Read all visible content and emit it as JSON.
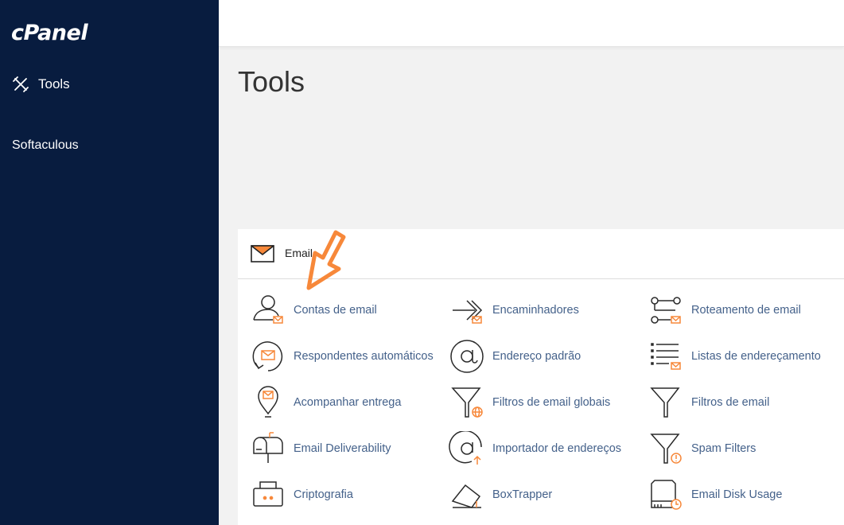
{
  "sidebar": {
    "logo": "cPanel",
    "tools_label": "Tools",
    "softaculous_label": "Softaculous"
  },
  "page": {
    "title": "Tools"
  },
  "email_section": {
    "title": "Email",
    "items": [
      {
        "label": "Contas de email",
        "icon": "email-accounts-icon"
      },
      {
        "label": "Encaminhadores",
        "icon": "forwarders-icon"
      },
      {
        "label": "Roteamento de email",
        "icon": "email-routing-icon"
      },
      {
        "label": "Respondentes automáticos",
        "icon": "autoresponders-icon"
      },
      {
        "label": "Endereço padrão",
        "icon": "default-address-icon"
      },
      {
        "label": "Listas de endereçamento",
        "icon": "mailing-lists-icon"
      },
      {
        "label": "Acompanhar entrega",
        "icon": "track-delivery-icon"
      },
      {
        "label": "Filtros de email globais",
        "icon": "global-filters-icon"
      },
      {
        "label": "Filtros de email",
        "icon": "email-filters-icon"
      },
      {
        "label": "Email Deliverability",
        "icon": "mailbox-icon"
      },
      {
        "label": "Importador de endereços",
        "icon": "address-importer-icon"
      },
      {
        "label": "Spam Filters",
        "icon": "spam-filters-icon"
      },
      {
        "label": "Criptografia",
        "icon": "encryption-icon"
      },
      {
        "label": "BoxTrapper",
        "icon": "boxtrapper-icon"
      },
      {
        "label": "Email Disk Usage",
        "icon": "disk-usage-icon"
      }
    ]
  },
  "colors": {
    "sidebar_bg": "#081c3f",
    "accent": "#f7883a",
    "link": "#44618a"
  }
}
